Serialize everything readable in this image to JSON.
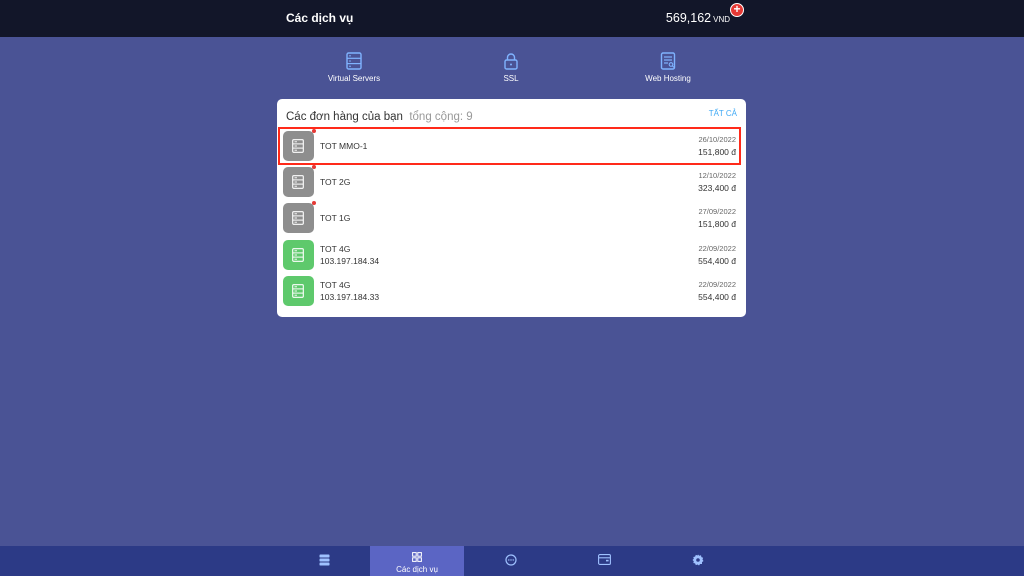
{
  "header": {
    "title": "Các dịch vụ",
    "balance_amount": "569,162",
    "balance_currency": "VND",
    "add_label": "+"
  },
  "services": [
    {
      "label": "Virtual Servers",
      "icon": "server-icon"
    },
    {
      "label": "SSL",
      "icon": "lock-icon"
    },
    {
      "label": "Web Hosting",
      "icon": "hosting-doc-icon"
    }
  ],
  "orders": {
    "title": "Các đơn hàng của bạn",
    "total": "tổng cộng: 9",
    "view_all": "TẤT CẢ",
    "items": [
      {
        "name": "TOT MMO-1",
        "ip": "",
        "date": "26/10/2022",
        "price": "151,800 đ",
        "status": "inactive",
        "has_dot": true
      },
      {
        "name": "TOT 2G",
        "ip": "",
        "date": "12/10/2022",
        "price": "323,400 đ",
        "status": "inactive",
        "has_dot": true
      },
      {
        "name": "TOT 1G",
        "ip": "",
        "date": "27/09/2022",
        "price": "151,800 đ",
        "status": "inactive",
        "has_dot": true
      },
      {
        "name": "TOT 4G",
        "ip": "103.197.184.34",
        "date": "22/09/2022",
        "price": "554,400 đ",
        "status": "active",
        "has_dot": false
      },
      {
        "name": "TOT 4G",
        "ip": "103.197.184.33",
        "date": "22/09/2022",
        "price": "554,400 đ",
        "status": "active",
        "has_dot": false
      }
    ]
  },
  "bottom_nav": [
    {
      "label": "",
      "icon": "server-list-icon"
    },
    {
      "label": "Các dịch vụ",
      "icon": "grid-icon",
      "active": true
    },
    {
      "label": "",
      "icon": "chat-icon"
    },
    {
      "label": "",
      "icon": "wallet-icon"
    },
    {
      "label": "",
      "icon": "gear-icon"
    }
  ],
  "colors": {
    "background": "#4a5395",
    "topbar": "#121629",
    "bottombar": "#2c3a86",
    "active_tab": "#5b65c4",
    "inactive_icon": "#8e8e8e",
    "active_icon": "#5ec96c",
    "highlight": "#ff2a1a",
    "link": "#3fa9f5"
  }
}
